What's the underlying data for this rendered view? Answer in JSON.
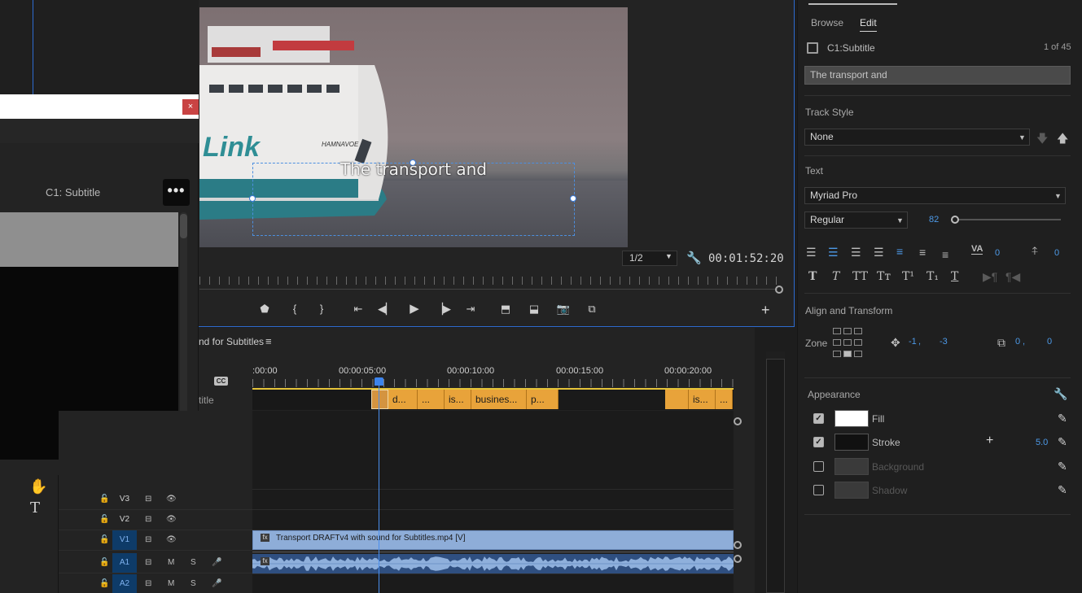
{
  "left_panel": {
    "dialog_close": "×",
    "caption_title": "C1: Subtitle",
    "more_label": "•••"
  },
  "tools": {
    "hand": "✋",
    "type": "T"
  },
  "monitor": {
    "subtitle_overlay": "The transport and",
    "resolution": "1/2",
    "timecode": "00:01:52:20",
    "ship_name": "HAMNAVOE",
    "logo_text": "Link",
    "transport_buttons": [
      "marker",
      "in",
      "out",
      "go-to-in",
      "step-back",
      "play",
      "step-forward",
      "go-to-out",
      "lift",
      "extract",
      "export-frame",
      "compare"
    ],
    "add_label": "+"
  },
  "timeline": {
    "sequence_name": "nd for Subtitles",
    "menu_icon": "≡",
    "ruler_labels": [
      ":00:00",
      "00:00:05:00",
      "00:00:10:00",
      "00:00:15:00",
      "00:00:20:00"
    ],
    "cc_label": "CC",
    "subtitle_track_label": "title",
    "captions": [
      {
        "text": ""
      },
      {
        "text": "d..."
      },
      {
        "text": "..."
      },
      {
        "text": "is..."
      },
      {
        "text": "busines..."
      },
      {
        "text": "p..."
      },
      {
        "text": ""
      },
      {
        "text": "is..."
      },
      {
        "text": "..."
      }
    ],
    "tracks": [
      {
        "name": "V3",
        "active": false,
        "lock": "🔓",
        "sync": "⊟",
        "toggle": "👁"
      },
      {
        "name": "V2",
        "active": false,
        "lock": "🔓",
        "sync": "⊟",
        "toggle": "👁"
      },
      {
        "name": "V1",
        "active": true,
        "lock": "🔓",
        "sync": "⊟",
        "toggle": "👁"
      },
      {
        "name": "A1",
        "active": true,
        "lock": "🔓",
        "sync": "⊟",
        "mute": "M",
        "solo": "S"
      },
      {
        "name": "A2",
        "active": true,
        "lock": "🔓",
        "sync": "⊟",
        "mute": "M",
        "solo": "S"
      }
    ],
    "video_clip_name": "Transport DRAFTv4 with sound for Subtitles.mp4 [V]",
    "fx_badge": "fx"
  },
  "essential_graphics": {
    "tabs": [
      "Browse",
      "Edit"
    ],
    "active_tab": "Edit",
    "layer_name": "C1:Subtitle",
    "layer_count": "1 of 45",
    "text_value": "The transport and",
    "track_style_label": "Track Style",
    "track_style_value": "None",
    "text_label": "Text",
    "font_family": "Myriad Pro",
    "font_style": "Regular",
    "font_size": "82",
    "tracking_value": "0",
    "leading_value": "0",
    "align_transform_label": "Align and Transform",
    "zone_label": "Zone",
    "position_x": "-1",
    "position_y": "-3",
    "anchor_x": "0",
    "anchor_y": "0",
    "comma": ",",
    "appearance_label": "Appearance",
    "fill_label": "Fill",
    "stroke_label": "Stroke",
    "stroke_width": "5.0",
    "background_label": "Background",
    "shadow_label": "Shadow",
    "fill_color": "#ffffff",
    "stroke_color": "#111111",
    "checked": "✓",
    "add": "+",
    "style_buttons": [
      "T",
      "T",
      "TT",
      "Tт",
      "T¹",
      "T₁",
      "T"
    ]
  },
  "colors": {
    "accent": "#2d6bd0",
    "caption_clip": "#e8a33a",
    "video_clip": "#8eadd8",
    "audio_clip": "#2f4f80"
  }
}
